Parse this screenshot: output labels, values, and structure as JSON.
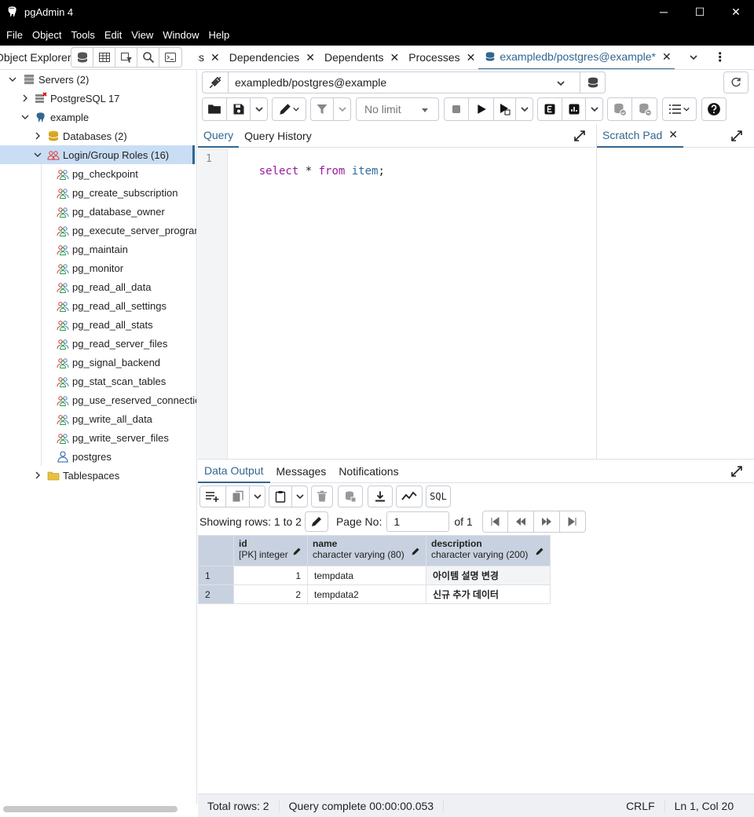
{
  "window": {
    "title": "pgAdmin 4",
    "minimize": "─",
    "maximize": "☐",
    "close": "✕"
  },
  "menu": [
    "File",
    "Object",
    "Tools",
    "Edit",
    "View",
    "Window",
    "Help"
  ],
  "explorer": {
    "title": "Object Explorer",
    "servers_label": "Servers (2)",
    "server1": "PostgreSQL 17",
    "server2": "example",
    "databases": "Databases (2)",
    "roles": "Login/Group Roles (16)",
    "role_items": [
      "pg_checkpoint",
      "pg_create_subscription",
      "pg_database_owner",
      "pg_execute_server_program",
      "pg_maintain",
      "pg_monitor",
      "pg_read_all_data",
      "pg_read_all_settings",
      "pg_read_all_stats",
      "pg_read_server_files",
      "pg_signal_backend",
      "pg_stat_scan_tables",
      "pg_use_reserved_connections",
      "pg_write_all_data",
      "pg_write_server_files",
      "postgres"
    ],
    "tablespaces": "Tablespaces"
  },
  "tabs": {
    "t1": "Statistics",
    "t2": "Dependencies",
    "t3": "Dependents",
    "t4": "Processes",
    "t5": "exampledb/postgres@example*"
  },
  "connection": {
    "value": "exampledb/postgres@example"
  },
  "toolbar": {
    "limit": "No limit"
  },
  "query_tabs": {
    "query": "Query",
    "history": "Query History",
    "scratch": "Scratch Pad"
  },
  "editor": {
    "line_no": "1",
    "kw1": "select",
    "star": "*",
    "kw2": "from",
    "ident": "item",
    "semi": ";"
  },
  "output_tabs": {
    "data": "Data Output",
    "messages": "Messages",
    "notifications": "Notifications"
  },
  "pager": {
    "showing": "Showing rows: 1 to 2",
    "page_no_label": "Page No:",
    "page_value": "1",
    "of": "of 1"
  },
  "grid": {
    "columns": [
      {
        "name": "id",
        "type": "[PK] integer"
      },
      {
        "name": "name",
        "type": "character varying (80)"
      },
      {
        "name": "description",
        "type": "character varying (200)"
      }
    ],
    "rows": [
      {
        "n": "1",
        "id": "1",
        "name": "tempdata",
        "description": "아이템 설명 변경"
      },
      {
        "n": "2",
        "id": "2",
        "name": "tempdata2",
        "description": "신규 추가 데이터"
      }
    ]
  },
  "status": {
    "total": "Total rows: 2",
    "complete": "Query complete 00:00:00.053",
    "eol": "CRLF",
    "pos": "Ln 1, Col 20"
  },
  "colors": {
    "accent": "#326690",
    "keyword": "#9a1a9a",
    "ident": "#2c6aa0"
  }
}
